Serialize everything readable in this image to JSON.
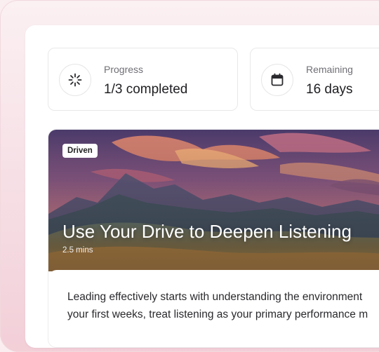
{
  "stats": {
    "progress": {
      "label": "Progress",
      "value": "1/3 completed",
      "icon": "loading-spinner-icon"
    },
    "remaining": {
      "label": "Remaining",
      "value": "16 days",
      "icon": "calendar-icon"
    }
  },
  "course": {
    "badge": "Driven",
    "title": "Use Your Drive to Deepen Listening",
    "duration": "2.5 mins",
    "body_lines": [
      "Leading effectively starts with understanding the environment",
      "your first weeks, treat listening as your primary performance m"
    ]
  },
  "colors": {
    "background": "#f6e0e6",
    "card_border": "#e8e8ea",
    "text_primary": "#202024",
    "text_secondary": "#6f6f76"
  }
}
